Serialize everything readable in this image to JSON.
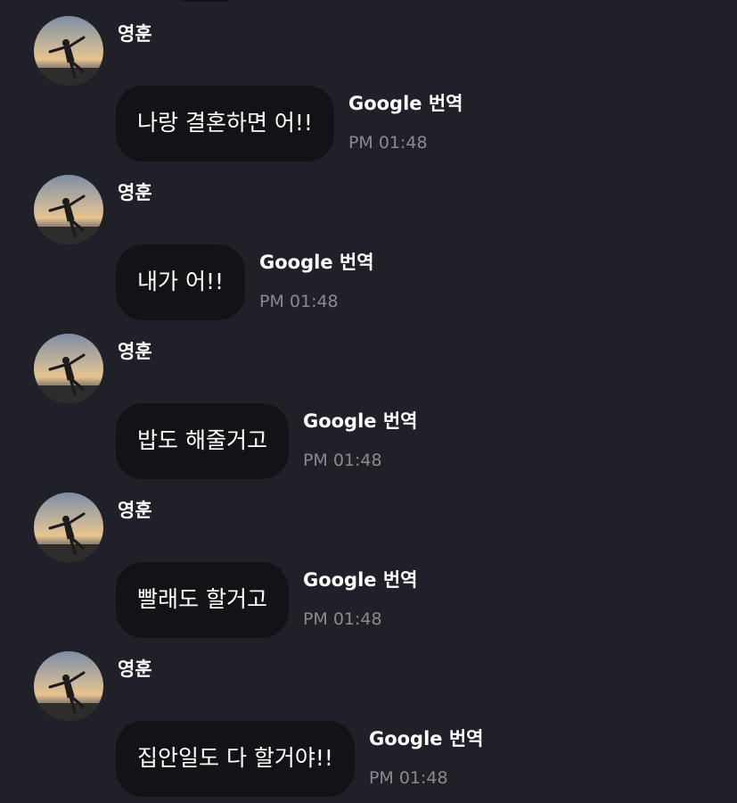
{
  "messages": [
    {
      "sender": "영훈",
      "text": "나랑 결혼하면 어!!",
      "translate_label": "Google 번역",
      "time": "PM 01:48"
    },
    {
      "sender": "영훈",
      "text": "내가 어!!",
      "translate_label": "Google 번역",
      "time": "PM 01:48"
    },
    {
      "sender": "영훈",
      "text": "밥도 해줄거고",
      "translate_label": "Google 번역",
      "time": "PM 01:48"
    },
    {
      "sender": "영훈",
      "text": "빨래도 할거고",
      "translate_label": "Google 번역",
      "time": "PM 01:48"
    },
    {
      "sender": "영훈",
      "text": "집안일도 다 할거야!!",
      "translate_label": "Google 번역",
      "time": "PM 01:48"
    }
  ],
  "colors": {
    "background": "#202028",
    "bubble": "#131317",
    "text": "#ffffff",
    "timestamp": "#8a8a8e"
  }
}
